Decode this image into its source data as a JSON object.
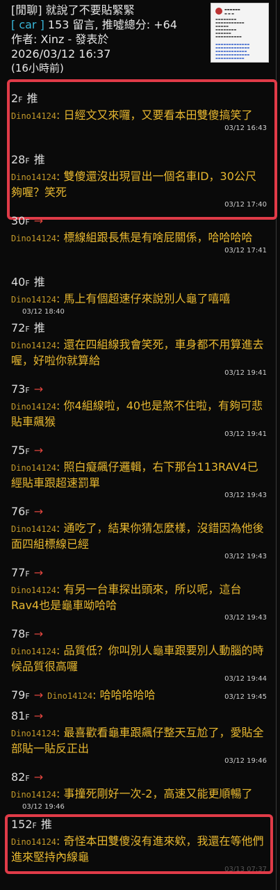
{
  "header": {
    "title": "[閒聊] 就說了不要貼緊緊",
    "board": "[ car ]",
    "meta": " 153 留言, 推噓總分: +64",
    "author": "作者: Xinz - 發表於",
    "datetime": "2026/03/12 16:37",
    "relative": "(16小時前)"
  },
  "comments": [
    {
      "floor": "2",
      "tag": "推",
      "user": "Dino14124",
      "text": "日經文又來囉，又要看本田雙傻搞笑了",
      "time": "03/12 16:43"
    },
    {
      "floor": "28",
      "tag": "推",
      "user": "Dino14124",
      "text": "雙傻還沒出現冒出一個名車ID，30公尺夠喔？笑死",
      "time": "03/12 17:40"
    },
    {
      "floor": "30",
      "tag": "→",
      "user": "Dino14124",
      "text": "標線組跟長焦是有啥屁關係，哈哈哈哈",
      "time": "03/12 17:41"
    },
    {
      "floor": "40",
      "tag": "推",
      "user": "Dino14124",
      "text": "馬上有個超速仔來說別人龜了嘻嘻",
      "time": "03/12 18:40"
    },
    {
      "floor": "72",
      "tag": "推",
      "user": "Dino14124",
      "text": "還在四組線我會笑死，車身都不用算進去喔，好啦你就算給",
      "time": "03/12 19:41"
    },
    {
      "floor": "73",
      "tag": "→",
      "user": "Dino14124",
      "text": "你4組線啦，40也是煞不住啦，有夠可悲貼車飆猴",
      "time": "03/12 19:41"
    },
    {
      "floor": "75",
      "tag": "→",
      "user": "Dino14124",
      "text": "照白癡飆仔邏輯，右下那台113RAV4已經貼車跟超速罰單",
      "time": "03/12 19:43"
    },
    {
      "floor": "76",
      "tag": "→",
      "user": "Dino14124",
      "text": "通吃了，結果你猜怎麼樣，沒錯因為他後面四組標線已經",
      "time": "03/12 19:43"
    },
    {
      "floor": "77",
      "tag": "→",
      "user": "Dino14124",
      "text": "有另一台車探出頭來，所以呢，這台Rav4也是龜車呦哈哈",
      "time": "03/12 19:43"
    },
    {
      "floor": "78",
      "tag": "→",
      "user": "Dino14124",
      "text": "品質低？你叫別人龜車跟要別人動腦的時候品質很高囉",
      "time": "03/12 19:44"
    },
    {
      "floor": "79",
      "tag": "→",
      "user": "Dino14124",
      "text": "哈哈哈哈哈",
      "time": "03/12 19:45"
    },
    {
      "floor": "81",
      "tag": "→",
      "user": "Dino14124",
      "text": "最喜歡看龜車跟飆仔整天互尬了，愛貼全部貼一貼反正出",
      "time": "03/12 19:46"
    },
    {
      "floor": "82",
      "tag": "→",
      "user": "Dino14124",
      "text": "事撞死剛好一次-2，高速又能更順暢了",
      "time": "03/12 19:46"
    },
    {
      "floor": "152",
      "tag": "推",
      "user": "Dino14124",
      "text": "奇怪本田雙傻沒有進來欸，我還在等他們進來堅持內線龜",
      "time": "03/13 07:37"
    }
  ],
  "floor_suffix": "F"
}
